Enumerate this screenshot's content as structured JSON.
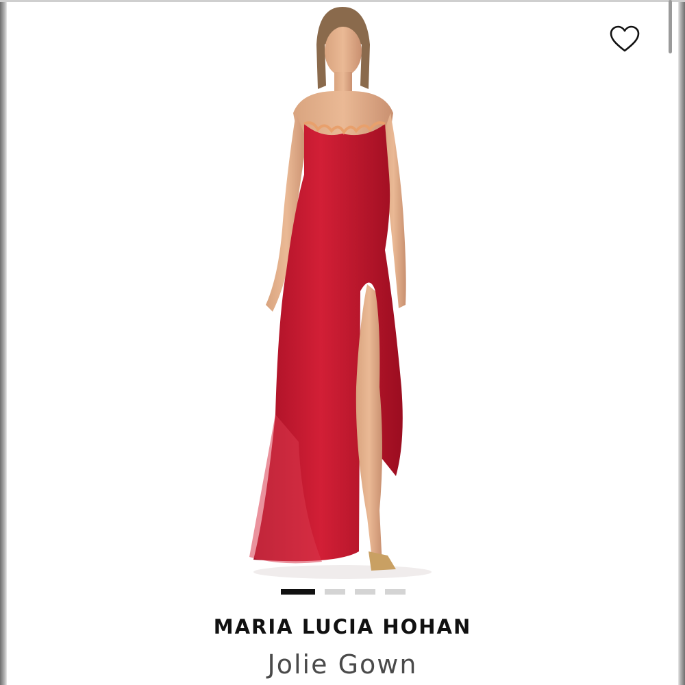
{
  "product": {
    "brand": "MARIA LUCIA HOHAN",
    "name": "Jolie Gown",
    "dress_color": "#c0162e"
  },
  "wishlist": {
    "icon": "heart-outline-icon"
  },
  "gallery": {
    "total_images": 4,
    "current_index": 1
  }
}
